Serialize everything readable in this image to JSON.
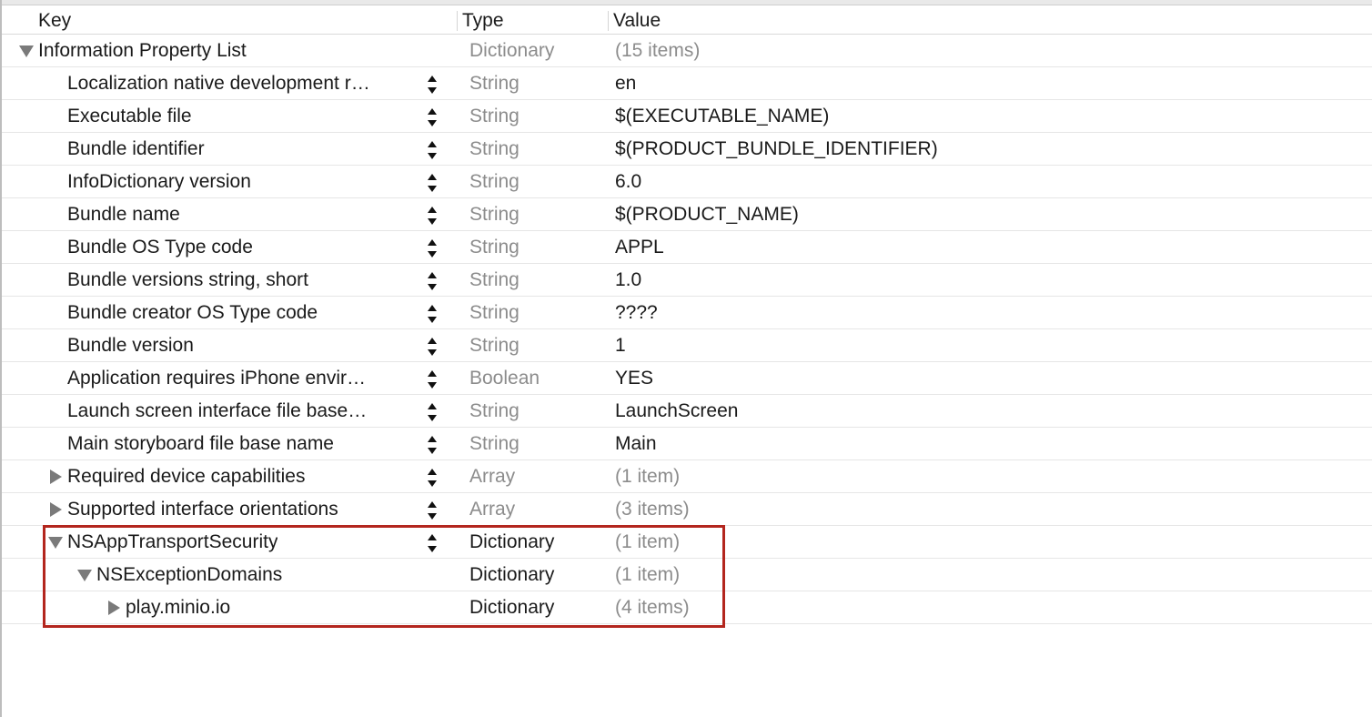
{
  "columns": {
    "key": "Key",
    "type": "Type",
    "value": "Value"
  },
  "rows": [
    {
      "key": "Information Property List",
      "type": "Dictionary",
      "value": "(15 items)",
      "level": 0,
      "disclosure": "open",
      "stepper": false,
      "type_dim": true,
      "value_dim": true
    },
    {
      "key": "Localization native development r…",
      "type": "String",
      "value": "en",
      "level": 1,
      "disclosure": "none",
      "stepper": true,
      "type_dim": true,
      "value_dim": false
    },
    {
      "key": "Executable file",
      "type": "String",
      "value": "$(EXECUTABLE_NAME)",
      "level": 1,
      "disclosure": "none",
      "stepper": true,
      "type_dim": true,
      "value_dim": false
    },
    {
      "key": "Bundle identifier",
      "type": "String",
      "value": "$(PRODUCT_BUNDLE_IDENTIFIER)",
      "level": 1,
      "disclosure": "none",
      "stepper": true,
      "type_dim": true,
      "value_dim": false
    },
    {
      "key": "InfoDictionary version",
      "type": "String",
      "value": "6.0",
      "level": 1,
      "disclosure": "none",
      "stepper": true,
      "type_dim": true,
      "value_dim": false
    },
    {
      "key": "Bundle name",
      "type": "String",
      "value": "$(PRODUCT_NAME)",
      "level": 1,
      "disclosure": "none",
      "stepper": true,
      "type_dim": true,
      "value_dim": false
    },
    {
      "key": "Bundle OS Type code",
      "type": "String",
      "value": "APPL",
      "level": 1,
      "disclosure": "none",
      "stepper": true,
      "type_dim": true,
      "value_dim": false
    },
    {
      "key": "Bundle versions string, short",
      "type": "String",
      "value": "1.0",
      "level": 1,
      "disclosure": "none",
      "stepper": true,
      "type_dim": true,
      "value_dim": false
    },
    {
      "key": "Bundle creator OS Type code",
      "type": "String",
      "value": "????",
      "level": 1,
      "disclosure": "none",
      "stepper": true,
      "type_dim": true,
      "value_dim": false
    },
    {
      "key": "Bundle version",
      "type": "String",
      "value": "1",
      "level": 1,
      "disclosure": "none",
      "stepper": true,
      "type_dim": true,
      "value_dim": false
    },
    {
      "key": "Application requires iPhone envir…",
      "type": "Boolean",
      "value": "YES",
      "level": 1,
      "disclosure": "none",
      "stepper": true,
      "type_dim": true,
      "value_dim": false
    },
    {
      "key": "Launch screen interface file base…",
      "type": "String",
      "value": "LaunchScreen",
      "level": 1,
      "disclosure": "none",
      "stepper": true,
      "type_dim": true,
      "value_dim": false
    },
    {
      "key": "Main storyboard file base name",
      "type": "String",
      "value": "Main",
      "level": 1,
      "disclosure": "none",
      "stepper": true,
      "type_dim": true,
      "value_dim": false
    },
    {
      "key": "Required device capabilities",
      "type": "Array",
      "value": "(1 item)",
      "level": 1,
      "disclosure": "closed",
      "stepper": true,
      "type_dim": true,
      "value_dim": true
    },
    {
      "key": "Supported interface orientations",
      "type": "Array",
      "value": "(3 items)",
      "level": 1,
      "disclosure": "closed",
      "stepper": true,
      "type_dim": true,
      "value_dim": true
    },
    {
      "key": "NSAppTransportSecurity",
      "type": "Dictionary",
      "value": "(1 item)",
      "level": 1,
      "disclosure": "open",
      "stepper": true,
      "type_dim": false,
      "value_dim": true
    },
    {
      "key": "NSExceptionDomains",
      "type": "Dictionary",
      "value": "(1 item)",
      "level": 2,
      "disclosure": "open",
      "stepper": false,
      "type_dim": false,
      "value_dim": true
    },
    {
      "key": "play.minio.io",
      "type": "Dictionary",
      "value": "(4 items)",
      "level": 3,
      "disclosure": "closed",
      "stepper": false,
      "type_dim": false,
      "value_dim": true
    }
  ],
  "icons": {
    "disclosure_open": "triangle-down-icon",
    "disclosure_closed": "triangle-right-icon",
    "stepper": "up-down-stepper-icon"
  },
  "colors": {
    "text": "#1a1a1a",
    "dim_text": "#8c8c8c",
    "triangle": "#7a7a7a",
    "highlight": "#b3261e",
    "row_rule": "#e6e6e6"
  },
  "highlight": {
    "rows": [
      "NSAppTransportSecurity",
      "NSExceptionDomains",
      "play.minio.io"
    ]
  }
}
